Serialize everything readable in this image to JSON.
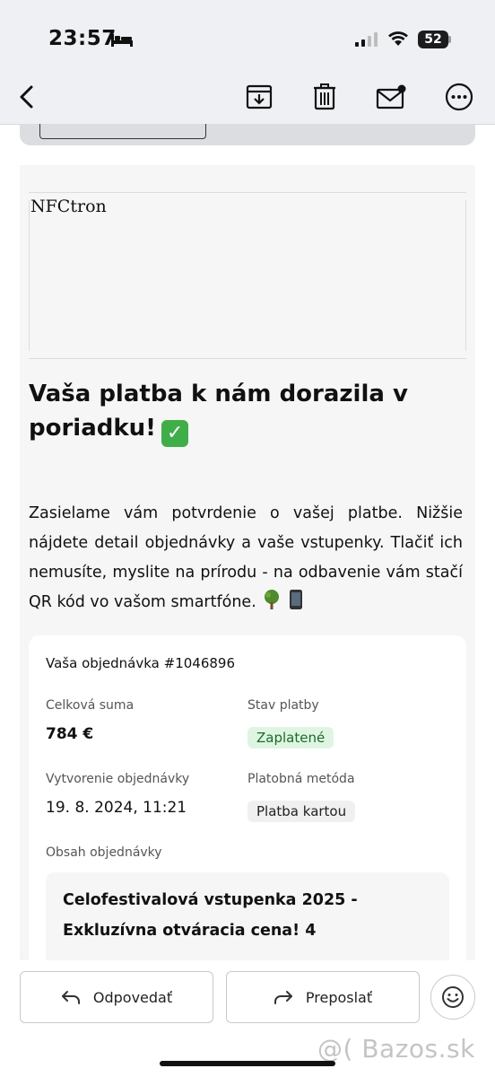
{
  "status": {
    "time": "23:57",
    "battery": "52"
  },
  "toolbar": {
    "back": "back-arrow-icon",
    "archive": "archive-icon",
    "delete": "trash-icon",
    "mark_unread": "mail-unread-icon",
    "more": "more-icon"
  },
  "email": {
    "brand": "NFCtron",
    "headline": "Vaša platba k nám dorazila v poriadku!",
    "headline_emoji": "✓",
    "intro": "Zasielame vám potvrdenie o vašej platbe. Nižšie nájdete detail objednávky a vaše vstupenky. Tlačiť ich nemusíte, myslite na prírodu - na odbavenie vám stačí QR kód vo vašom smartfóne."
  },
  "order": {
    "title": "Vaša objednávka #1046896",
    "total_label": "Celková suma",
    "total_value": "784 €",
    "payment_status_label": "Stav platby",
    "payment_status_value": "Zaplatené",
    "created_label": "Vytvorenie objednávky",
    "created_value": "19. 8. 2024, 11:21",
    "method_label": "Platobná metóda",
    "method_value": "Platba kartou",
    "contents_label": "Obsah objednávky",
    "item_title": "Celofestivalová vstupenka 2025 - Exkluzívna otváracia cena! 4"
  },
  "actions": {
    "reply": "Odpovedať",
    "forward": "Preposlať",
    "emoji": "emoji-icon"
  },
  "watermark": "@( Bazos.sk",
  "colors": {
    "paid_badge_bg": "#dff5e2",
    "paid_badge_text": "#1a6b2a",
    "check_green": "#3fae49"
  }
}
